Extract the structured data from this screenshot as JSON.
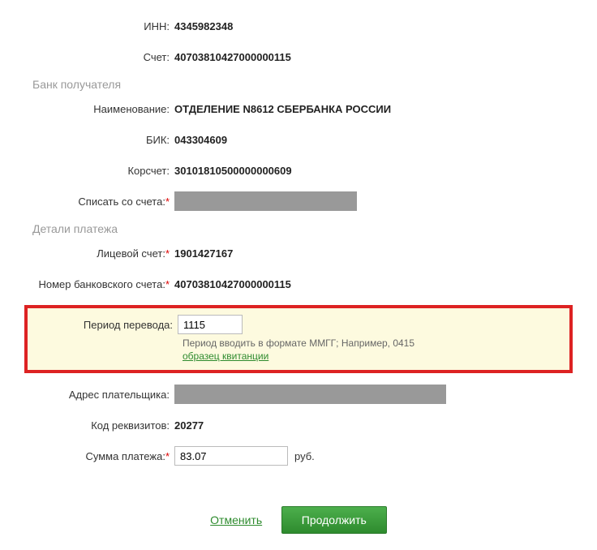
{
  "inn": {
    "label": "ИНН:",
    "value": "4345982348"
  },
  "account": {
    "label": "Счет:",
    "value": "40703810427000000115"
  },
  "bankSection": "Банк получателя",
  "bankName": {
    "label": "Наименование:",
    "value": "ОТДЕЛЕНИЕ N8612 СБЕРБАНКА РОССИИ"
  },
  "bik": {
    "label": "БИК:",
    "value": "043304609"
  },
  "corrAccount": {
    "label": "Корсчет:",
    "value": "30101810500000000609"
  },
  "debitAccount": {
    "label": "Списать со счета:"
  },
  "detailsSection": "Детали платежа",
  "personalAccount": {
    "label": "Лицевой счет:",
    "value": "1901427167"
  },
  "bankAccountNum": {
    "label": "Номер банковского счета:",
    "value": "40703810427000000115"
  },
  "transferPeriod": {
    "label": "Период перевода:",
    "value": "1115",
    "hint": "Период вводить в формате ММГГ; Например, 0415",
    "sampleLink": "образец квитанции"
  },
  "payerAddress": {
    "label": "Адрес плательщика:"
  },
  "requisitesCode": {
    "label": "Код реквизитов:",
    "value": "20277"
  },
  "paymentAmount": {
    "label": "Сумма платежа:",
    "value": "83.07",
    "unit": "руб."
  },
  "actions": {
    "cancel": "Отменить",
    "continue": "Продолжить"
  }
}
